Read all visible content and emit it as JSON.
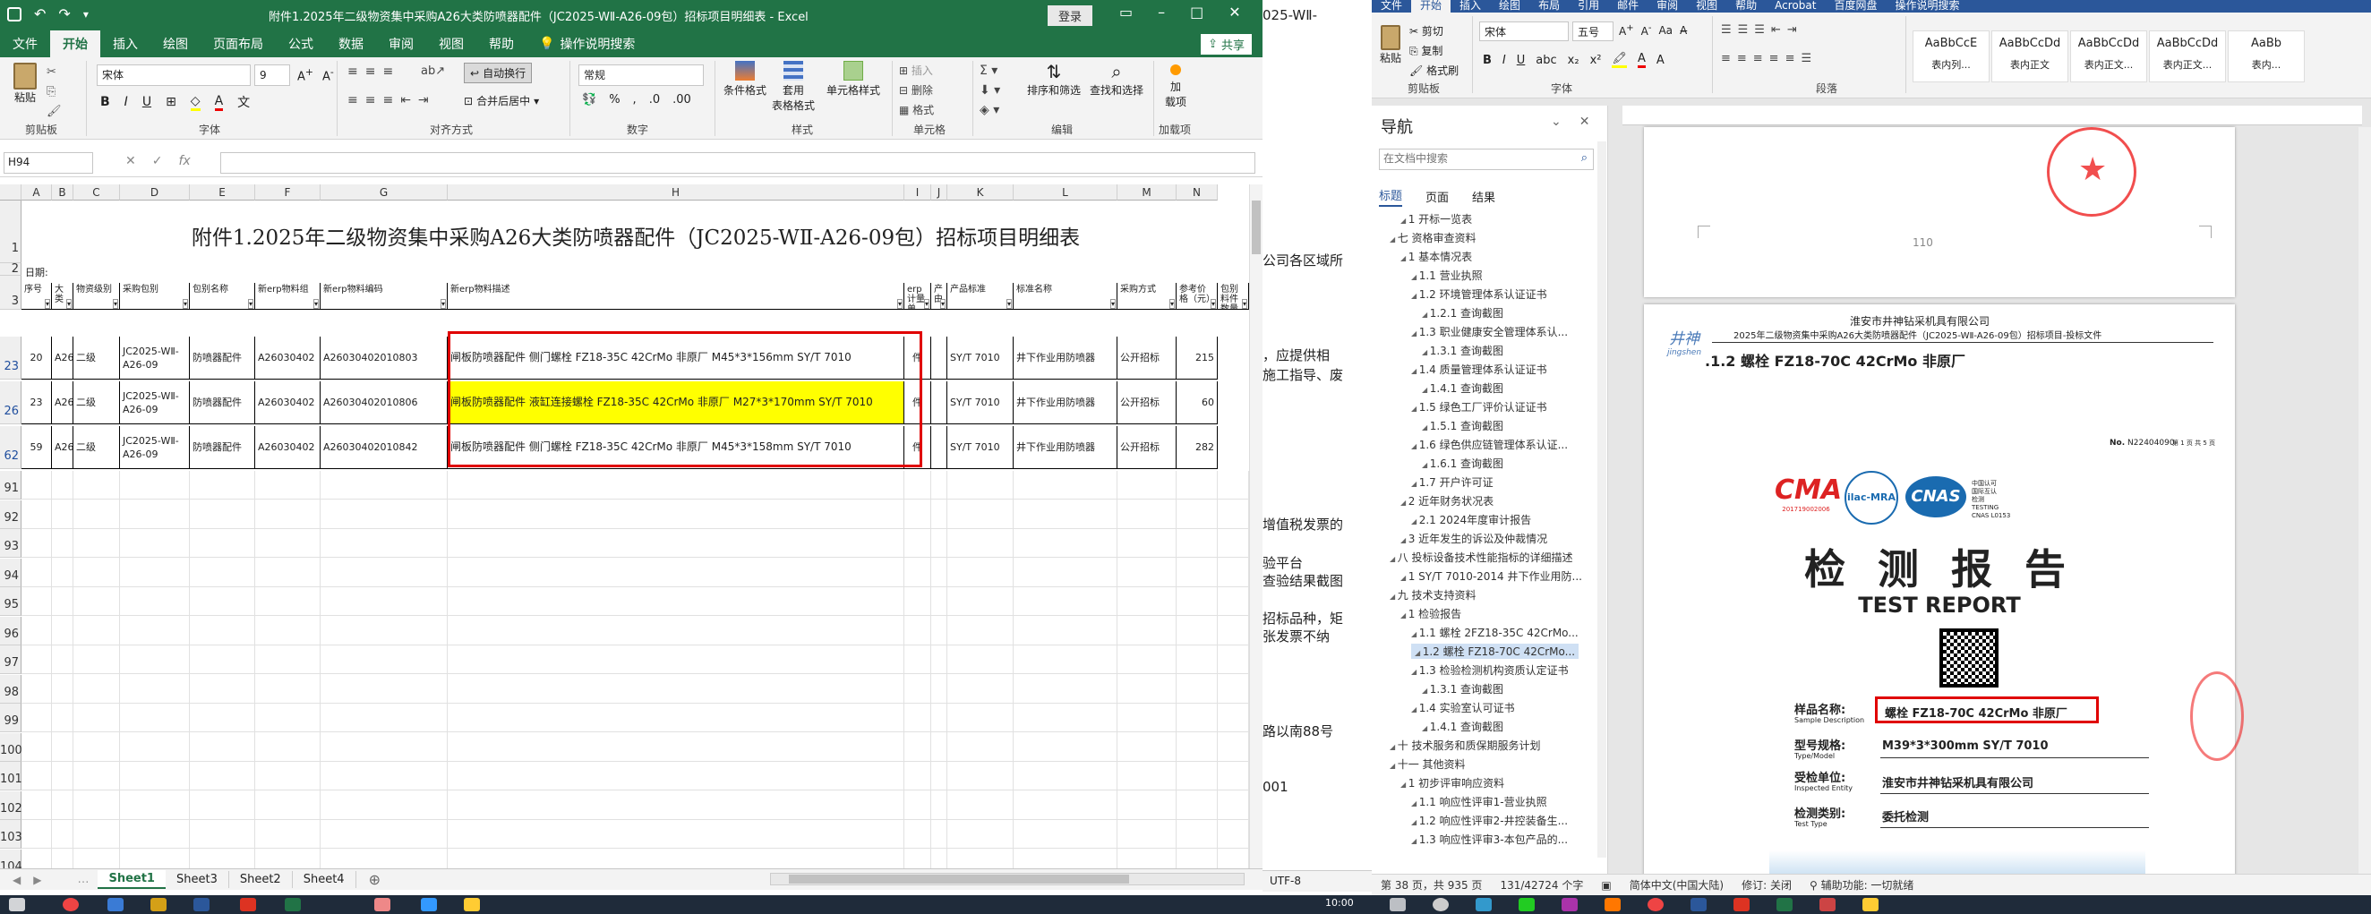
{
  "excel": {
    "title": "附件1.2025年二级物资集中采购A26大类防喷器配件（JC2025-WⅡ-A26-09包）招标项目明细表 - Excel",
    "login_label": "登录",
    "tabs": [
      "文件",
      "开始",
      "插入",
      "绘图",
      "页面布局",
      "公式",
      "数据",
      "审阅",
      "视图",
      "帮助"
    ],
    "tell_me": "操作说明搜索",
    "share_label": "共享",
    "ribbon": {
      "paste": "粘贴",
      "clipboard": "剪贴板",
      "font_name": "宋体",
      "font_size": "9",
      "font_group": "字体",
      "wrap_text": "自动换行",
      "merge_center": "合并后居中",
      "align_group": "对齐方式",
      "number_format": "常规",
      "number_group": "数字",
      "cond_format": "条件格式",
      "table_format": "套用\n表格格式",
      "cell_style": "单元格样式",
      "style_group": "样式",
      "insert": "插入",
      "delete": "删除",
      "format": "格式",
      "cells_group": "单元格",
      "sort_filter": "排序和筛选",
      "find_select": "查找和选择",
      "edit_group": "编辑",
      "addins": "加\n载项",
      "addins_group": "加载项"
    },
    "name_box": "H94",
    "fx": "fx",
    "columns": [
      "A",
      "B",
      "C",
      "D",
      "E",
      "F",
      "G",
      "H",
      "I",
      "J",
      "K",
      "L",
      "M",
      "N"
    ],
    "sheet_title": "附件1.2025年二级物资集中采购A26大类防喷器配件（JC2025-WⅡ-A26-09包）招标项目明细表",
    "date_label": "日期:",
    "headers": [
      "序号",
      "大类",
      "物资级别",
      "采购包别",
      "包别名称",
      "新erp物料组",
      "新erp物料编码",
      "新erp物料描述",
      "erp计量单",
      "产由",
      "产品标准",
      "标准名称",
      "采购方式",
      "参考价格（元）",
      "包别料件数量"
    ],
    "rows": [
      {
        "rownum": "23",
        "seq": "20",
        "cat": "A26",
        "level": "二级",
        "pkg": "JC2025-WⅡ-A26-09",
        "pkgname": "防喷器配件",
        "group": "A26030402",
        "code": "A26030402010803",
        "desc": "闸板防喷器配件 侧门螺栓 FZ18-35C 42CrMo 非原厂 M45*3*156mm SY/T 7010",
        "unit": "件",
        "std": "SY/T 7010",
        "stdname": "井下作业用防喷器",
        "method": "公开招标",
        "price": "215"
      },
      {
        "rownum": "26",
        "seq": "23",
        "cat": "A26",
        "level": "二级",
        "pkg": "JC2025-WⅡ-A26-09",
        "pkgname": "防喷器配件",
        "group": "A26030402",
        "code": "A26030402010806",
        "desc": "闸板防喷器配件 液缸连接螺栓 FZ18-35C 42CrMo 非原厂 M27*3*170mm SY/T 7010",
        "unit": "件",
        "std": "SY/T 7010",
        "stdname": "井下作业用防喷器",
        "method": "公开招标",
        "price": "60"
      },
      {
        "rownum": "62",
        "seq": "59",
        "cat": "A26",
        "level": "二级",
        "pkg": "JC2025-WⅡ-A26-09",
        "pkgname": "防喷器配件",
        "group": "A26030402",
        "code": "A26030402010842",
        "desc": "闸板防喷器配件 侧门螺栓 FZ18-35C 42CrMo 非原厂 M45*3*158mm SY/T 7010",
        "unit": "件",
        "std": "SY/T 7010",
        "stdname": "井下作业用防喷器",
        "method": "公开招标",
        "price": "282"
      }
    ],
    "empty_rows": [
      "91",
      "92",
      "93",
      "94",
      "95",
      "96",
      "97",
      "98",
      "99",
      "100",
      "101",
      "102",
      "103",
      "104"
    ],
    "sheets": [
      "Sheet1",
      "Sheet3",
      "Sheet2",
      "Sheet4"
    ],
    "encoding": "UTF-8"
  },
  "word_under": {
    "lines": [
      "025-WⅡ-",
      "公司各区域所",
      "，应提供相",
      "施工指导、废",
      "增值税发票的",
      "验平台",
      "查验结果截图",
      "招标品种，矩",
      "张发票不纳",
      "路以南88号",
      "001"
    ]
  },
  "word": {
    "tabs": [
      "文件",
      "开始",
      "插入",
      "绘图",
      "布局",
      "引用",
      "邮件",
      "审阅",
      "视图",
      "帮助",
      "Acrobat",
      "百度网盘",
      "操作说明搜索"
    ],
    "ribbon": {
      "cut": "剪切",
      "copy": "复制",
      "format_painter": "格式刷",
      "paste": "粘贴",
      "clipboard": "剪贴板",
      "font_name": "宋体",
      "font_size": "五号",
      "font_group": "字体",
      "para_group": "段落",
      "styles": [
        {
          "preview": "AaBbCcE",
          "name": "表内列..."
        },
        {
          "preview": "AaBbCcDd",
          "name": "表内正文"
        },
        {
          "preview": "AaBbCcDd",
          "name": "表内正文..."
        },
        {
          "preview": "AaBbCcDd",
          "name": "表内正文..."
        },
        {
          "preview": "AaBb",
          "name": "表内..."
        }
      ]
    },
    "nav": {
      "title": "导航",
      "search_placeholder": "在文档中搜索",
      "tabs": [
        "标题",
        "页面",
        "结果"
      ],
      "items": [
        {
          "text": "1 开标一览表",
          "indent": 2
        },
        {
          "text": "七 资格审查资料",
          "indent": 1
        },
        {
          "text": "1 基本情况表",
          "indent": 2
        },
        {
          "text": "1.1 营业执照",
          "indent": 3
        },
        {
          "text": "1.2 环境管理体系认证证书",
          "indent": 3
        },
        {
          "text": "1.2.1 查询截图",
          "indent": 4
        },
        {
          "text": "1.3 职业健康安全管理体系认...",
          "indent": 3
        },
        {
          "text": "1.3.1 查询截图",
          "indent": 4
        },
        {
          "text": "1.4 质量管理体系认证证书",
          "indent": 3
        },
        {
          "text": "1.4.1 查询截图",
          "indent": 4
        },
        {
          "text": "1.5 绿色工厂评价认证证书",
          "indent": 3
        },
        {
          "text": "1.5.1 查询截图",
          "indent": 4
        },
        {
          "text": "1.6 绿色供应链管理体系认证...",
          "indent": 3
        },
        {
          "text": "1.6.1 查询截图",
          "indent": 4
        },
        {
          "text": "1.7 开户许可证",
          "indent": 3
        },
        {
          "text": "2 近年财务状况表",
          "indent": 2
        },
        {
          "text": "2.1 2024年度审计报告",
          "indent": 3
        },
        {
          "text": "3 近年发生的诉讼及仲裁情况",
          "indent": 2
        },
        {
          "text": "八 投标设备技术性能指标的详细描述",
          "indent": 1
        },
        {
          "text": "1 SY/T 7010-2014 井下作业用防...",
          "indent": 2
        },
        {
          "text": "九 技术支持资料",
          "indent": 1
        },
        {
          "text": "1 检验报告",
          "indent": 2
        },
        {
          "text": "1.1 螺栓 2FZ18-35C 42CrMo...",
          "indent": 3
        },
        {
          "text": "1.2 螺栓 FZ18-70C 42CrMo...",
          "indent": 3,
          "selected": true
        },
        {
          "text": "1.3 检验检测机构资质认定证书",
          "indent": 3
        },
        {
          "text": "1.3.1 查询截图",
          "indent": 4
        },
        {
          "text": "1.4 实验室认可证书",
          "indent": 3
        },
        {
          "text": "1.4.1 查询截图",
          "indent": 4
        },
        {
          "text": "十 技术服务和质保期服务计划",
          "indent": 1
        },
        {
          "text": "十一 其他资料",
          "indent": 1
        },
        {
          "text": "1 初步评审响应资料",
          "indent": 2
        },
        {
          "text": "1.1 响应性评审1-营业执照",
          "indent": 3
        },
        {
          "text": "1.2 响应性评审2-井控装备生...",
          "indent": 3
        },
        {
          "text": "1.3 响应性评审3-本包产品的...",
          "indent": 3
        }
      ]
    },
    "doc": {
      "page_num": "110",
      "company": "淮安市井神钻采机具有限公司",
      "header_line": "2025年二级物资集中采购A26大类防喷器配件（JC2025-WⅡ-A26-09包）招标项目-投标文件",
      "logo_text": "井神",
      "logo_sub": "jingshen",
      "heading": ".1.2 螺栓 FZ18-70C 42CrMo 非原厂",
      "report_no_label": "No.",
      "report_no": "N22404090",
      "page_of": "第 1 页 共 5 页",
      "cma": "CMA",
      "cma_no": "201719002006",
      "ilac": "ilac-MRA",
      "cnas": "CNAS",
      "cnas_text": "中国认可\n国际互认\n检测\nTESTING\nCNAS L0153",
      "report_cn": "检 测 报 告",
      "report_en": "TEST REPORT",
      "sample_label": "样品名称:",
      "sample_label_en": "Sample Description",
      "sample_value": "螺栓 FZ18-70C 42CrMo 非原厂",
      "model_label": "型号规格:",
      "model_label_en": "Type/Model",
      "model_value": "M39*3*300mm SY/T 7010",
      "entity_label": "受检单位:",
      "entity_label_en": "Inspected Entity",
      "entity_value": "淮安市井神钻采机具有限公司",
      "type_label": "检测类别:",
      "type_label_en": "Test Type",
      "type_value": "委托检测"
    },
    "status": {
      "page": "第 38 页，共 935 页",
      "words": "131/42724 个字",
      "lang": "简体中文(中国大陆)",
      "track": "修订: 关闭",
      "access": "辅助功能: 一切就绪"
    }
  },
  "taskbar": {
    "time": "10:00"
  }
}
